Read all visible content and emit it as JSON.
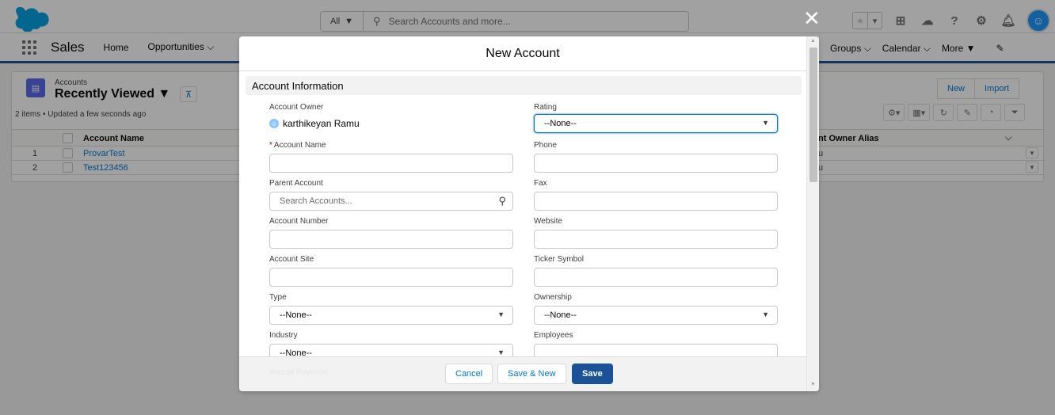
{
  "header": {
    "search_scope": "All",
    "search_placeholder": "Search Accounts and more..."
  },
  "nav": {
    "app_name": "Sales",
    "items": [
      "Home",
      "Opportunities"
    ],
    "right_items": [
      "Groups",
      "Calendar",
      "More"
    ]
  },
  "list_view": {
    "object": "Accounts",
    "title": "Recently Viewed",
    "meta": "2 items • Updated a few seconds ago",
    "buttons": [
      "New",
      "Import"
    ],
    "columns": [
      "Account Name",
      "nt Owner Alias"
    ],
    "rows": [
      {
        "num": "1",
        "name": "ProvarTest",
        "alias": "u"
      },
      {
        "num": "2",
        "name": "Test123456",
        "alias": "u"
      }
    ]
  },
  "modal": {
    "title": "New Account",
    "section": "Account Information",
    "fields": {
      "account_owner_label": "Account Owner",
      "account_owner_value": "karthikeyan Ramu",
      "rating_label": "Rating",
      "rating_value": "--None--",
      "account_name_label": "Account Name",
      "phone_label": "Phone",
      "parent_account_label": "Parent Account",
      "parent_account_placeholder": "Search Accounts...",
      "fax_label": "Fax",
      "account_number_label": "Account Number",
      "website_label": "Website",
      "account_site_label": "Account Site",
      "ticker_label": "Ticker Symbol",
      "type_label": "Type",
      "type_value": "--None--",
      "ownership_label": "Ownership",
      "ownership_value": "--None--",
      "industry_label": "Industry",
      "industry_value": "--None--",
      "employees_label": "Employees",
      "annual_revenue_label": "Annual Revenue"
    },
    "buttons": {
      "cancel": "Cancel",
      "save_new": "Save & New",
      "save": "Save"
    }
  },
  "colors": {
    "brand": "#1b5297",
    "link": "#0176d3",
    "required": "#ba0517"
  }
}
